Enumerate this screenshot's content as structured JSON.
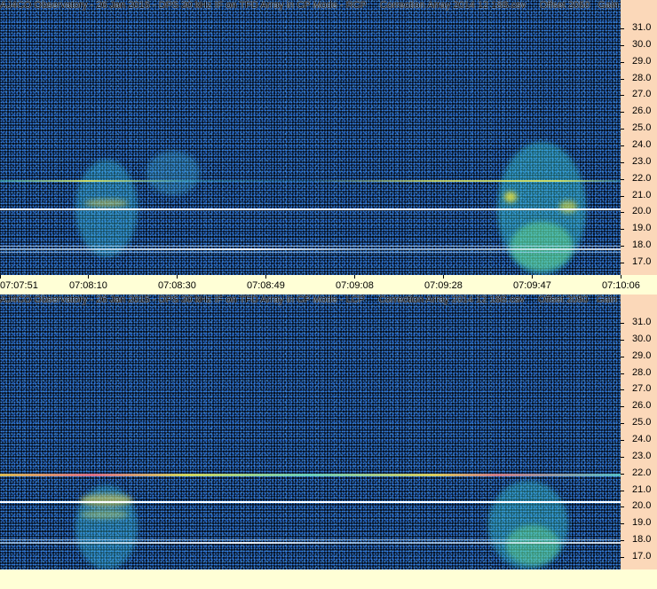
{
  "panels": [
    {
      "title": "AJ4CO Observatory - 26 Jan 2015 - DPS 30 kHz IF on TFD Array in CP Mode - RCP     Correction Array 2014 12 18B.csv     Offset 2050   Gain 5.0",
      "y_labels": [
        "31.0",
        "30.0",
        "29.0",
        "28.0",
        "27.0",
        "26.0",
        "25.0",
        "24.0",
        "23.0",
        "22.0",
        "21.0",
        "20.0",
        "19.0",
        "18.0",
        "17.0"
      ],
      "x_labels": [
        "07:07:51",
        "07:08:10",
        "07:08:30",
        "07:08:49",
        "07:09:08",
        "07:09:28",
        "07:09:47",
        "07:10:06"
      ]
    },
    {
      "title": "AJ4CO Observatory - 26 Jan 2015 - DPS 30 kHz IF on TFD Array in CP Mode - LCP     Correction Array 2014 12 18B.csv     Offset 2050   Gain 5.0",
      "y_labels": [
        "31.0",
        "30.0",
        "29.0",
        "28.0",
        "27.0",
        "26.0",
        "25.0",
        "24.0",
        "23.0",
        "22.0",
        "21.0",
        "20.0",
        "19.0",
        "18.0",
        "17.0"
      ]
    }
  ],
  "colors": {
    "background_noise": "#1e5fc3",
    "axis_y_bg": "#fbd8b9",
    "axis_x_bg": "#ffffd6",
    "marker_line": "#ffffff"
  }
}
